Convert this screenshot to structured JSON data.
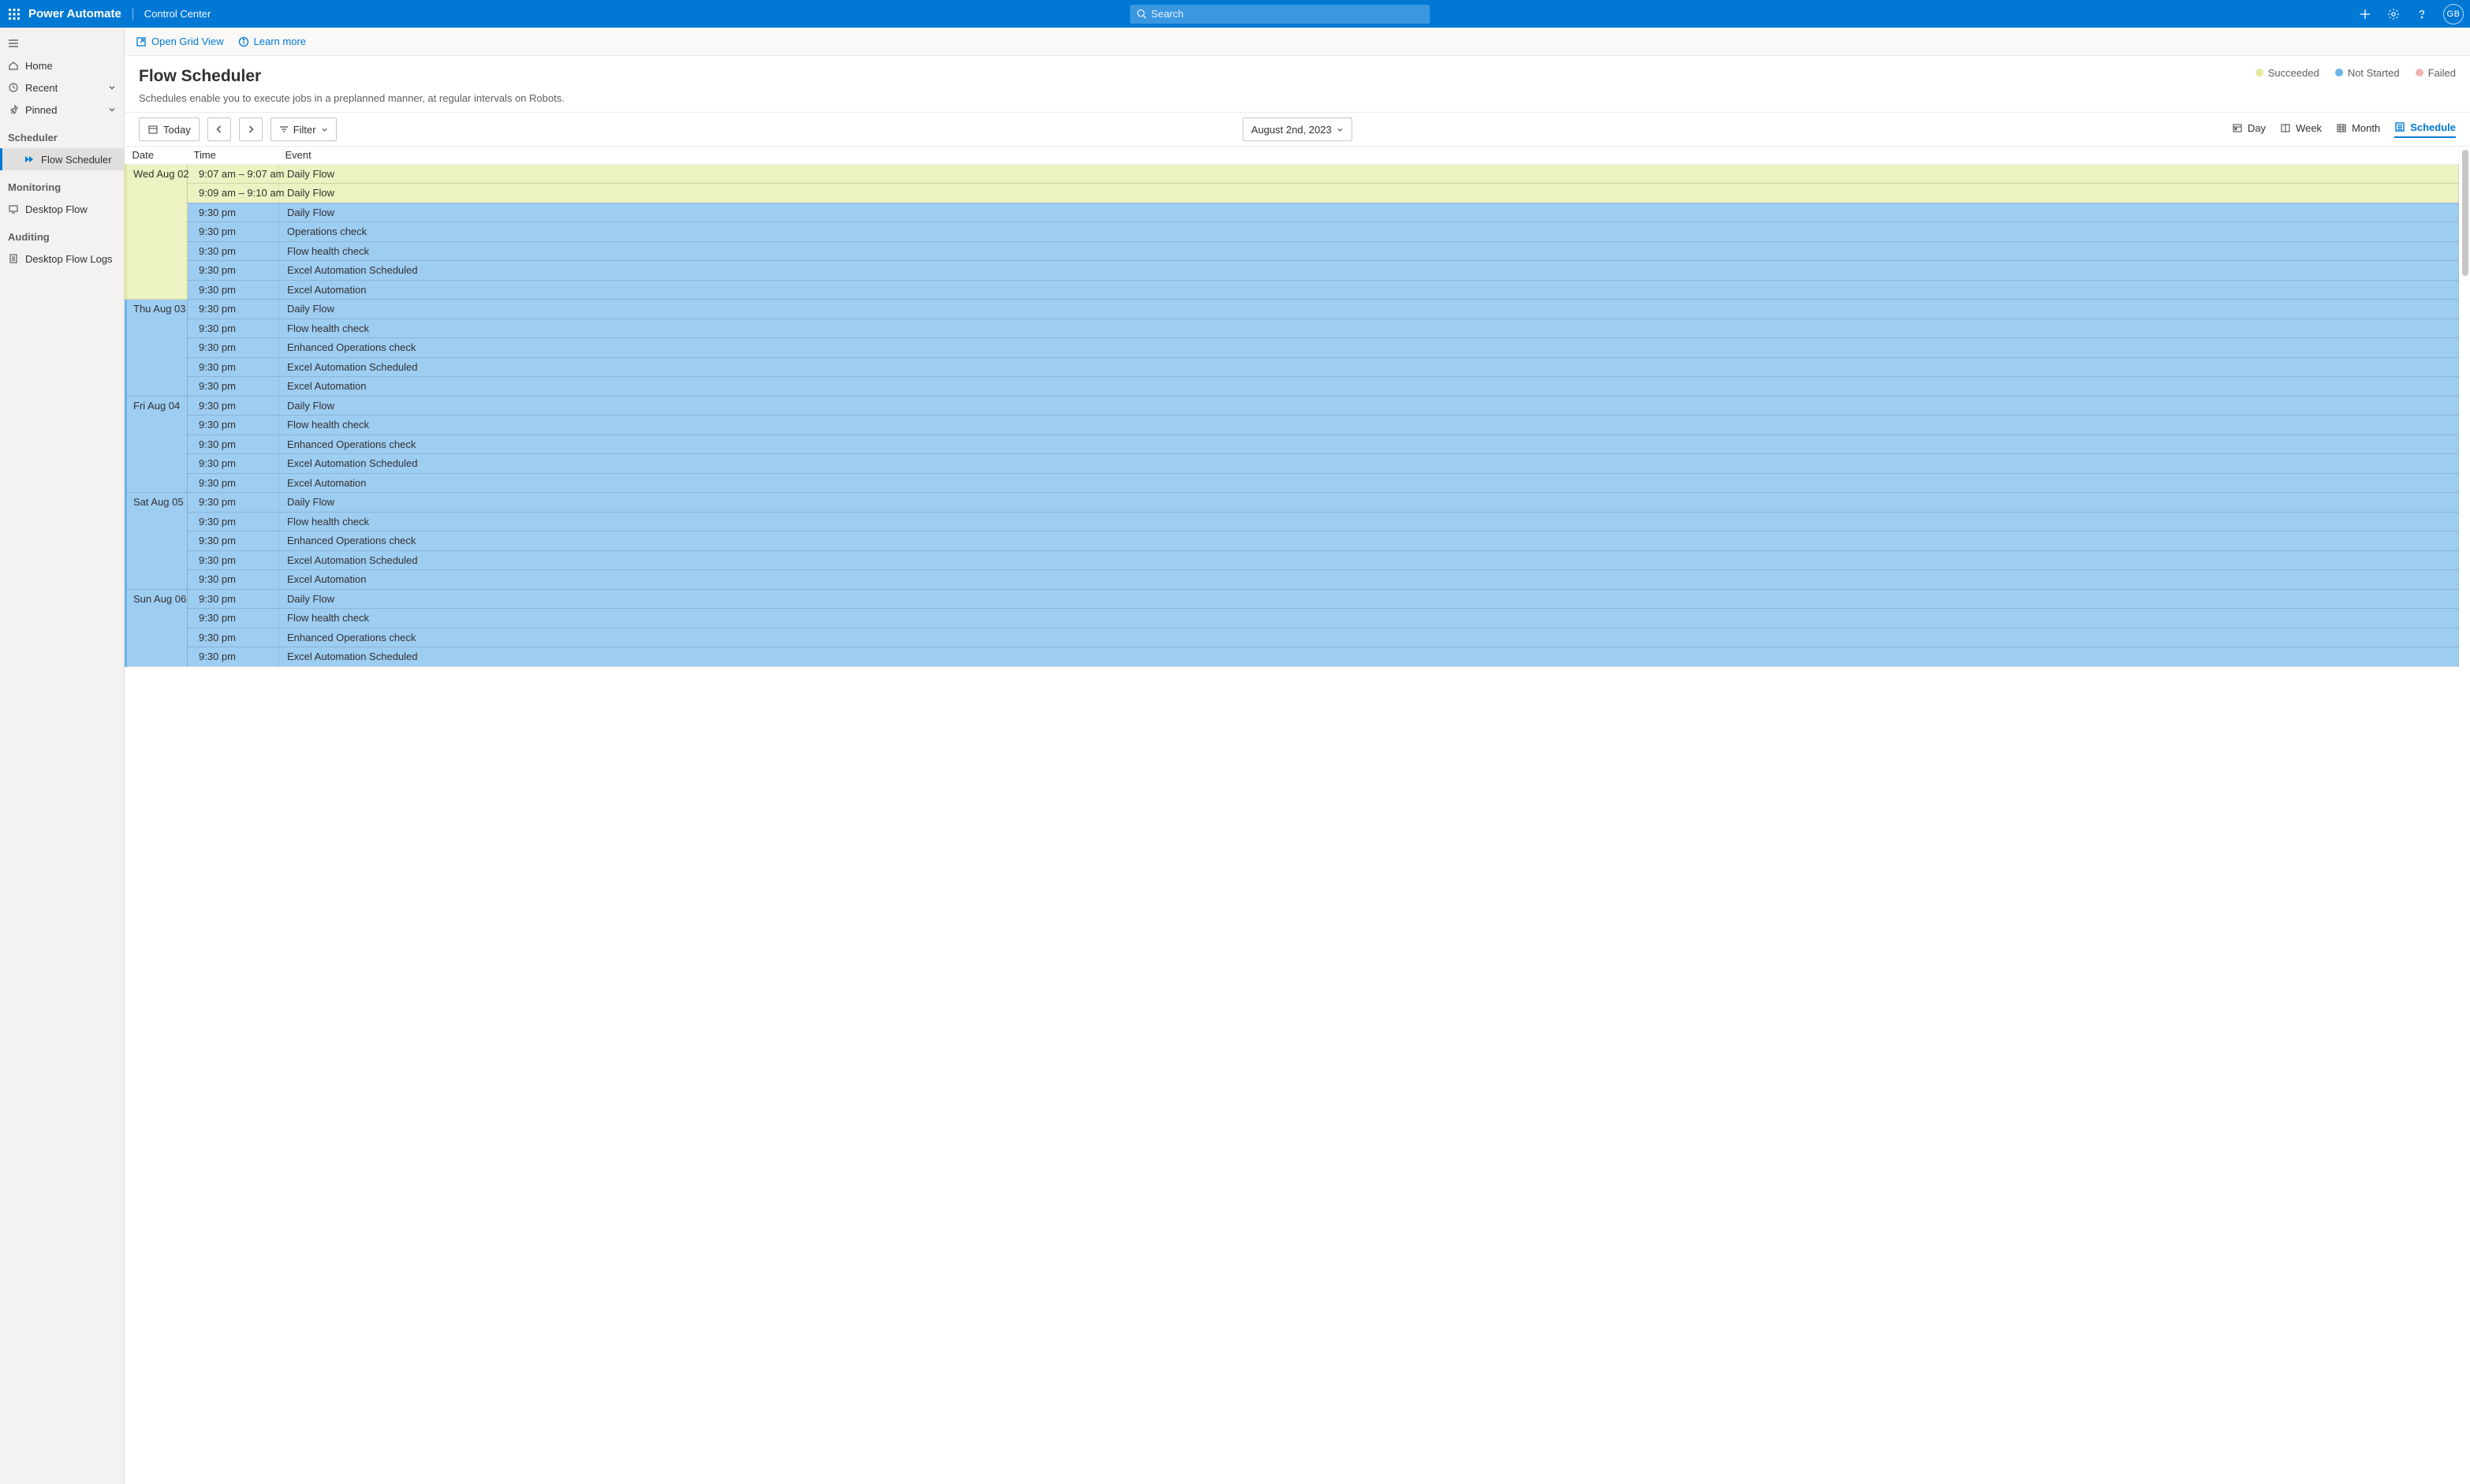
{
  "topbar": {
    "brand": "Power Automate",
    "subtitle": "Control Center",
    "search_placeholder": "Search",
    "avatar_initials": "GB"
  },
  "sidebar": {
    "home": "Home",
    "recent": "Recent",
    "pinned": "Pinned",
    "sections": {
      "scheduler": "Scheduler",
      "scheduler_item": "Flow Scheduler",
      "monitoring": "Monitoring",
      "monitoring_item": "Desktop Flow",
      "auditing": "Auditing",
      "auditing_item": "Desktop Flow Logs"
    }
  },
  "cmdbar": {
    "open_grid": "Open Grid View",
    "learn_more": "Learn more"
  },
  "header": {
    "title": "Flow Scheduler",
    "desc": "Schedules enable you to execute jobs in a preplanned manner, at regular intervals on Robots."
  },
  "legend": {
    "succeeded": {
      "label": "Succeeded",
      "color": "#e2e89d"
    },
    "notstarted": {
      "label": "Not Started",
      "color": "#6cb3e8"
    },
    "failed": {
      "label": "Failed",
      "color": "#f3b4b4"
    }
  },
  "toolbar": {
    "today": "Today",
    "filter": "Filter",
    "date": "August 2nd, 2023",
    "views": {
      "day": "Day",
      "week": "Week",
      "month": "Month",
      "schedule": "Schedule"
    },
    "active_view": "schedule"
  },
  "grid": {
    "columns": {
      "date": "Date",
      "time": "Time",
      "event": "Event"
    },
    "days": [
      {
        "date": "Wed Aug 02",
        "day_status": "succeeded",
        "rows": [
          {
            "time": "9:07 am – 9:07 am",
            "event": "Daily Flow",
            "status": "succeeded"
          },
          {
            "time": "9:09 am – 9:10 am",
            "event": "Daily Flow",
            "status": "succeeded"
          },
          {
            "time": "9:30 pm",
            "event": "Daily Flow",
            "status": "notstarted"
          },
          {
            "time": "9:30 pm",
            "event": "Operations check",
            "status": "notstarted"
          },
          {
            "time": "9:30 pm",
            "event": "Flow health check",
            "status": "notstarted"
          },
          {
            "time": "9:30 pm",
            "event": "Excel Automation Scheduled",
            "status": "notstarted"
          },
          {
            "time": "9:30 pm",
            "event": "Excel Automation",
            "status": "notstarted"
          }
        ]
      },
      {
        "date": "Thu Aug 03",
        "day_status": "notstarted",
        "rows": [
          {
            "time": "9:30 pm",
            "event": "Daily Flow",
            "status": "notstarted"
          },
          {
            "time": "9:30 pm",
            "event": "Flow health check",
            "status": "notstarted"
          },
          {
            "time": "9:30 pm",
            "event": "Enhanced Operations check",
            "status": "notstarted"
          },
          {
            "time": "9:30 pm",
            "event": "Excel Automation Scheduled",
            "status": "notstarted"
          },
          {
            "time": "9:30 pm",
            "event": "Excel Automation",
            "status": "notstarted"
          }
        ]
      },
      {
        "date": "Fri Aug 04",
        "day_status": "notstarted",
        "rows": [
          {
            "time": "9:30 pm",
            "event": "Daily Flow",
            "status": "notstarted"
          },
          {
            "time": "9:30 pm",
            "event": "Flow health check",
            "status": "notstarted"
          },
          {
            "time": "9:30 pm",
            "event": "Enhanced Operations check",
            "status": "notstarted"
          },
          {
            "time": "9:30 pm",
            "event": "Excel Automation Scheduled",
            "status": "notstarted"
          },
          {
            "time": "9:30 pm",
            "event": "Excel Automation",
            "status": "notstarted"
          }
        ]
      },
      {
        "date": "Sat Aug 05",
        "day_status": "notstarted",
        "rows": [
          {
            "time": "9:30 pm",
            "event": "Daily Flow",
            "status": "notstarted"
          },
          {
            "time": "9:30 pm",
            "event": "Flow health check",
            "status": "notstarted"
          },
          {
            "time": "9:30 pm",
            "event": "Enhanced Operations check",
            "status": "notstarted"
          },
          {
            "time": "9:30 pm",
            "event": "Excel Automation Scheduled",
            "status": "notstarted"
          },
          {
            "time": "9:30 pm",
            "event": "Excel Automation",
            "status": "notstarted"
          }
        ]
      },
      {
        "date": "Sun Aug 06",
        "day_status": "notstarted",
        "rows": [
          {
            "time": "9:30 pm",
            "event": "Daily Flow",
            "status": "notstarted"
          },
          {
            "time": "9:30 pm",
            "event": "Flow health check",
            "status": "notstarted"
          },
          {
            "time": "9:30 pm",
            "event": "Enhanced Operations check",
            "status": "notstarted"
          },
          {
            "time": "9:30 pm",
            "event": "Excel Automation Scheduled",
            "status": "notstarted"
          }
        ]
      }
    ]
  }
}
